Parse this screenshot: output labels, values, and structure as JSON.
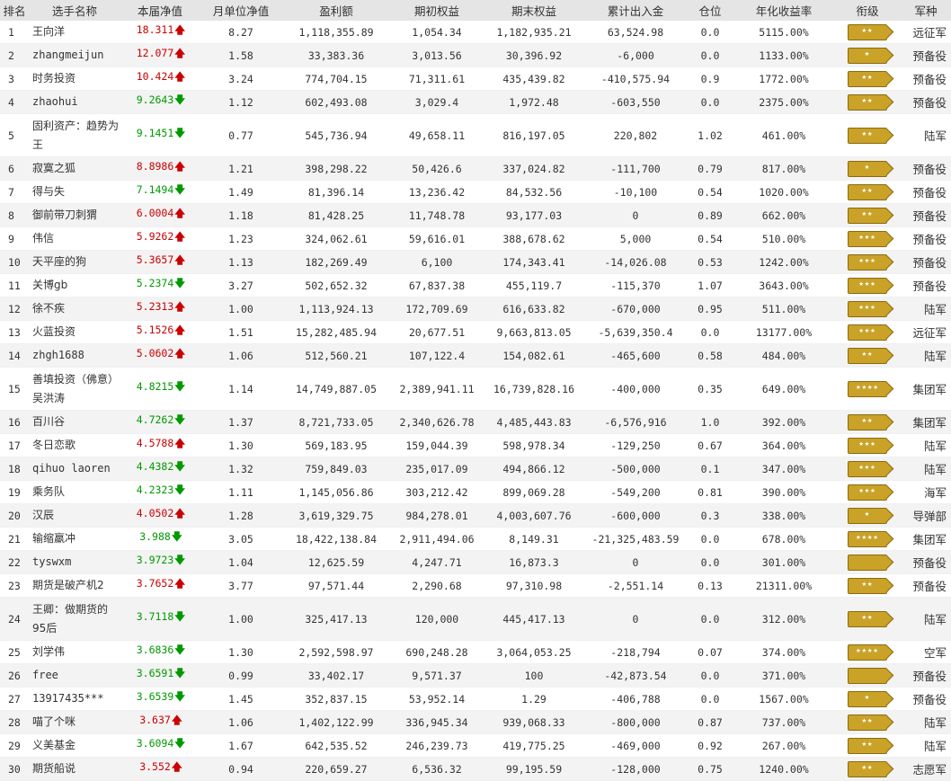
{
  "columns": [
    "排名",
    "选手名称",
    "本届净值",
    "月单位净值",
    "盈利额",
    "期初权益",
    "期末权益",
    "累计出入金",
    "仓位",
    "年化收益率",
    "衔级",
    "军种"
  ],
  "rows": [
    {
      "rank": "1",
      "name": "王向洋",
      "nv": "18.311",
      "dir": "up",
      "monthly": "8.27",
      "profit": "1,118,355.89",
      "begin": "1,054.34",
      "end": "1,182,935.21",
      "flow": "63,524.98",
      "pos": "0.0",
      "annual": "5115.00%",
      "badge": "★★",
      "army": "远征军"
    },
    {
      "rank": "2",
      "name": "zhangmeijun",
      "nv": "12.077",
      "dir": "up",
      "monthly": "1.58",
      "profit": "33,383.36",
      "begin": "3,013.56",
      "end": "30,396.92",
      "flow": "-6,000",
      "pos": "0.0",
      "annual": "1133.00%",
      "badge": "★",
      "army": "预备役"
    },
    {
      "rank": "3",
      "name": "时务投资",
      "nv": "10.424",
      "dir": "up",
      "monthly": "3.24",
      "profit": "774,704.15",
      "begin": "71,311.61",
      "end": "435,439.82",
      "flow": "-410,575.94",
      "pos": "0.9",
      "annual": "1772.00%",
      "badge": "★★",
      "army": "预备役"
    },
    {
      "rank": "4",
      "name": "zhaohui",
      "nv": "9.2643",
      "dir": "down",
      "monthly": "1.12",
      "profit": "602,493.08",
      "begin": "3,029.4",
      "end": "1,972.48",
      "flow": "-603,550",
      "pos": "0.0",
      "annual": "2375.00%",
      "badge": "★★",
      "army": "预备役"
    },
    {
      "rank": "5",
      "name": "固利资产：趋势为王",
      "nv": "9.1451",
      "dir": "down",
      "monthly": "0.77",
      "profit": "545,736.94",
      "begin": "49,658.11",
      "end": "816,197.05",
      "flow": "220,802",
      "pos": "1.02",
      "annual": "461.00%",
      "badge": "★★",
      "army": "陆军"
    },
    {
      "rank": "6",
      "name": "寂寞之狐",
      "nv": "8.8986",
      "dir": "up",
      "monthly": "1.21",
      "profit": "398,298.22",
      "begin": "50,426.6",
      "end": "337,024.82",
      "flow": "-111,700",
      "pos": "0.79",
      "annual": "817.00%",
      "badge": "★",
      "army": "预备役"
    },
    {
      "rank": "7",
      "name": "得与失",
      "nv": "7.1494",
      "dir": "down",
      "monthly": "1.49",
      "profit": "81,396.14",
      "begin": "13,236.42",
      "end": "84,532.56",
      "flow": "-10,100",
      "pos": "0.54",
      "annual": "1020.00%",
      "badge": "★★",
      "army": "预备役"
    },
    {
      "rank": "8",
      "name": "御前带刀刺猬",
      "nv": "6.0004",
      "dir": "up",
      "monthly": "1.18",
      "profit": "81,428.25",
      "begin": "11,748.78",
      "end": "93,177.03",
      "flow": "0",
      "pos": "0.89",
      "annual": "662.00%",
      "badge": "★★",
      "army": "预备役"
    },
    {
      "rank": "9",
      "name": "伟信",
      "nv": "5.9262",
      "dir": "up",
      "monthly": "1.23",
      "profit": "324,062.61",
      "begin": "59,616.01",
      "end": "388,678.62",
      "flow": "5,000",
      "pos": "0.54",
      "annual": "510.00%",
      "badge": "★★★",
      "army": "预备役"
    },
    {
      "rank": "10",
      "name": "天平座的狗",
      "nv": "5.3657",
      "dir": "up",
      "monthly": "1.13",
      "profit": "182,269.49",
      "begin": "6,100",
      "end": "174,343.41",
      "flow": "-14,026.08",
      "pos": "0.53",
      "annual": "1242.00%",
      "badge": "★★★",
      "army": "预备役"
    },
    {
      "rank": "11",
      "name": "关博gb",
      "nv": "5.2374",
      "dir": "down",
      "monthly": "3.27",
      "profit": "502,652.32",
      "begin": "67,837.38",
      "end": "455,119.7",
      "flow": "-115,370",
      "pos": "1.07",
      "annual": "3643.00%",
      "badge": "★★★",
      "army": "预备役"
    },
    {
      "rank": "12",
      "name": "徐不疾",
      "nv": "5.2313",
      "dir": "up",
      "monthly": "1.00",
      "profit": "1,113,924.13",
      "begin": "172,709.69",
      "end": "616,633.82",
      "flow": "-670,000",
      "pos": "0.95",
      "annual": "511.00%",
      "badge": "★★★",
      "army": "陆军"
    },
    {
      "rank": "13",
      "name": "火蓝投资",
      "nv": "5.1526",
      "dir": "up",
      "monthly": "1.51",
      "profit": "15,282,485.94",
      "begin": "20,677.51",
      "end": "9,663,813.05",
      "flow": "-5,639,350.4",
      "pos": "0.0",
      "annual": "13177.00%",
      "badge": "★★★",
      "army": "远征军"
    },
    {
      "rank": "14",
      "name": "zhgh1688",
      "nv": "5.0602",
      "dir": "up",
      "monthly": "1.06",
      "profit": "512,560.21",
      "begin": "107,122.4",
      "end": "154,082.61",
      "flow": "-465,600",
      "pos": "0.58",
      "annual": "484.00%",
      "badge": "★★",
      "army": "陆军"
    },
    {
      "rank": "15",
      "name": "善填投资（佛意）吴洪涛",
      "nv": "4.8215",
      "dir": "down",
      "monthly": "1.14",
      "profit": "14,749,887.05",
      "begin": "2,389,941.11",
      "end": "16,739,828.16",
      "flow": "-400,000",
      "pos": "0.35",
      "annual": "649.00%",
      "badge": "★★★★",
      "army": "集团军"
    },
    {
      "rank": "16",
      "name": "百川谷",
      "nv": "4.7262",
      "dir": "down",
      "monthly": "1.37",
      "profit": "8,721,733.05",
      "begin": "2,340,626.78",
      "end": "4,485,443.83",
      "flow": "-6,576,916",
      "pos": "1.0",
      "annual": "392.00%",
      "badge": "★★",
      "army": "集团军"
    },
    {
      "rank": "17",
      "name": "冬日恋歌",
      "nv": "4.5788",
      "dir": "up",
      "monthly": "1.30",
      "profit": "569,183.95",
      "begin": "159,044.39",
      "end": "598,978.34",
      "flow": "-129,250",
      "pos": "0.67",
      "annual": "364.00%",
      "badge": "★★★",
      "army": "陆军"
    },
    {
      "rank": "18",
      "name": "qihuo laoren",
      "nv": "4.4382",
      "dir": "down",
      "monthly": "1.32",
      "profit": "759,849.03",
      "begin": "235,017.09",
      "end": "494,866.12",
      "flow": "-500,000",
      "pos": "0.1",
      "annual": "347.00%",
      "badge": "★★★",
      "army": "陆军"
    },
    {
      "rank": "19",
      "name": "乘务队",
      "nv": "4.2323",
      "dir": "down",
      "monthly": "1.11",
      "profit": "1,145,056.86",
      "begin": "303,212.42",
      "end": "899,069.28",
      "flow": "-549,200",
      "pos": "0.81",
      "annual": "390.00%",
      "badge": "★★★",
      "army": "海军"
    },
    {
      "rank": "20",
      "name": "汉辰",
      "nv": "4.0502",
      "dir": "up",
      "monthly": "1.28",
      "profit": "3,619,329.75",
      "begin": "984,278.01",
      "end": "4,003,607.76",
      "flow": "-600,000",
      "pos": "0.3",
      "annual": "338.00%",
      "badge": "★",
      "army": "导弹部"
    },
    {
      "rank": "21",
      "name": "输缩羸冲",
      "nv": "3.988",
      "dir": "down",
      "monthly": "3.05",
      "profit": "18,422,138.84",
      "begin": "2,911,494.06",
      "end": "8,149.31",
      "flow": "-21,325,483.59",
      "pos": "0.0",
      "annual": "678.00%",
      "badge": "★★★★",
      "army": "集团军"
    },
    {
      "rank": "22",
      "name": "tyswxm",
      "nv": "3.9723",
      "dir": "down",
      "monthly": "1.04",
      "profit": "12,625.59",
      "begin": "4,247.71",
      "end": "16,873.3",
      "flow": "0",
      "pos": "0.0",
      "annual": "301.00%",
      "badge": "",
      "army": "预备役"
    },
    {
      "rank": "23",
      "name": "期货是破产机2",
      "nv": "3.7652",
      "dir": "up",
      "monthly": "3.77",
      "profit": "97,571.44",
      "begin": "2,290.68",
      "end": "97,310.98",
      "flow": "-2,551.14",
      "pos": "0.13",
      "annual": "21311.00%",
      "badge": "★★",
      "army": "预备役"
    },
    {
      "rank": "24",
      "name": "王卿：做期货的95后",
      "nv": "3.7118",
      "dir": "down",
      "monthly": "1.00",
      "profit": "325,417.13",
      "begin": "120,000",
      "end": "445,417.13",
      "flow": "0",
      "pos": "0.0",
      "annual": "312.00%",
      "badge": "★★",
      "army": "陆军"
    },
    {
      "rank": "25",
      "name": "刘学伟",
      "nv": "3.6836",
      "dir": "down",
      "monthly": "1.30",
      "profit": "2,592,598.97",
      "begin": "690,248.28",
      "end": "3,064,053.25",
      "flow": "-218,794",
      "pos": "0.07",
      "annual": "374.00%",
      "badge": "★★★★",
      "army": "空军"
    },
    {
      "rank": "26",
      "name": "free",
      "nv": "3.6591",
      "dir": "down",
      "monthly": "0.99",
      "profit": "33,402.17",
      "begin": "9,571.37",
      "end": "100",
      "flow": "-42,873.54",
      "pos": "0.0",
      "annual": "371.00%",
      "badge": "",
      "army": "预备役"
    },
    {
      "rank": "27",
      "name": "13917435***",
      "nv": "3.6539",
      "dir": "down",
      "monthly": "1.45",
      "profit": "352,837.15",
      "begin": "53,952.14",
      "end": "1.29",
      "flow": "-406,788",
      "pos": "0.0",
      "annual": "1567.00%",
      "badge": "★",
      "army": "预备役"
    },
    {
      "rank": "28",
      "name": "喵了个咪",
      "nv": "3.637",
      "dir": "up",
      "monthly": "1.06",
      "profit": "1,402,122.99",
      "begin": "336,945.34",
      "end": "939,068.33",
      "flow": "-800,000",
      "pos": "0.87",
      "annual": "737.00%",
      "badge": "★★",
      "army": "陆军"
    },
    {
      "rank": "29",
      "name": "义美基金",
      "nv": "3.6094",
      "dir": "down",
      "monthly": "1.67",
      "profit": "642,535.52",
      "begin": "246,239.73",
      "end": "419,775.25",
      "flow": "-469,000",
      "pos": "0.92",
      "annual": "267.00%",
      "badge": "★★",
      "army": "陆军"
    },
    {
      "rank": "30",
      "name": "期货船说",
      "nv": "3.552",
      "dir": "up",
      "monthly": "0.94",
      "profit": "220,659.27",
      "begin": "6,536.32",
      "end": "99,195.59",
      "flow": "-128,000",
      "pos": "0.75",
      "annual": "1240.00%",
      "badge": "★★",
      "army": "志愿军"
    }
  ],
  "colors": {
    "up": "#cc0000",
    "down": "#009900",
    "header_bg": "#e5e5e5",
    "badge": "#c9a227"
  },
  "arrows": {
    "up": "🡅",
    "down": "🡇"
  }
}
